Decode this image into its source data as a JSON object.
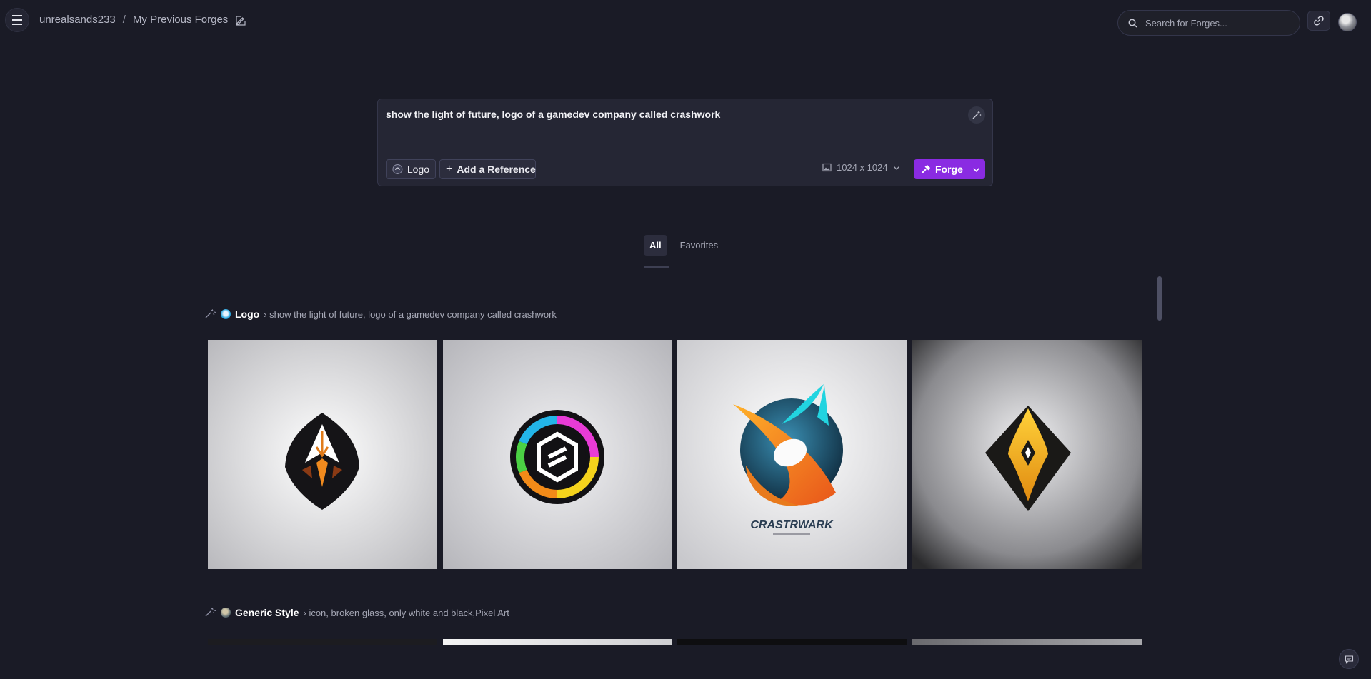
{
  "header": {
    "username": "unrealsands233",
    "separator": "/",
    "page_title": "My Previous Forges",
    "search_placeholder": "Search for Forges..."
  },
  "prompt": {
    "text": "show the light of future, logo of a gamedev company called crashwork",
    "style_chip": "Logo",
    "reference_button": "Add a Reference",
    "size": "1024 x 1024",
    "forge_button": "Forge"
  },
  "tabs": [
    {
      "label": "All",
      "active": true
    },
    {
      "label": "Favorites",
      "active": false
    }
  ],
  "groups": [
    {
      "style": "Logo",
      "prompt": "› show the light of future, logo of a gamedev company called crashwork",
      "images": [
        {
          "name": "black-shield-arrow-logo"
        },
        {
          "name": "rainbow-hexagon-logo"
        },
        {
          "name": "crashwork-orb-logo",
          "caption": "CRASTRWARK"
        },
        {
          "name": "yellow-diamond-logo"
        }
      ]
    },
    {
      "style": "Generic Style",
      "prompt": "› icon, broken glass, only white and black,Pixel Art"
    }
  ],
  "colors": {
    "background": "#1a1b26",
    "panel": "#252634",
    "accent": "#8a2be2"
  }
}
